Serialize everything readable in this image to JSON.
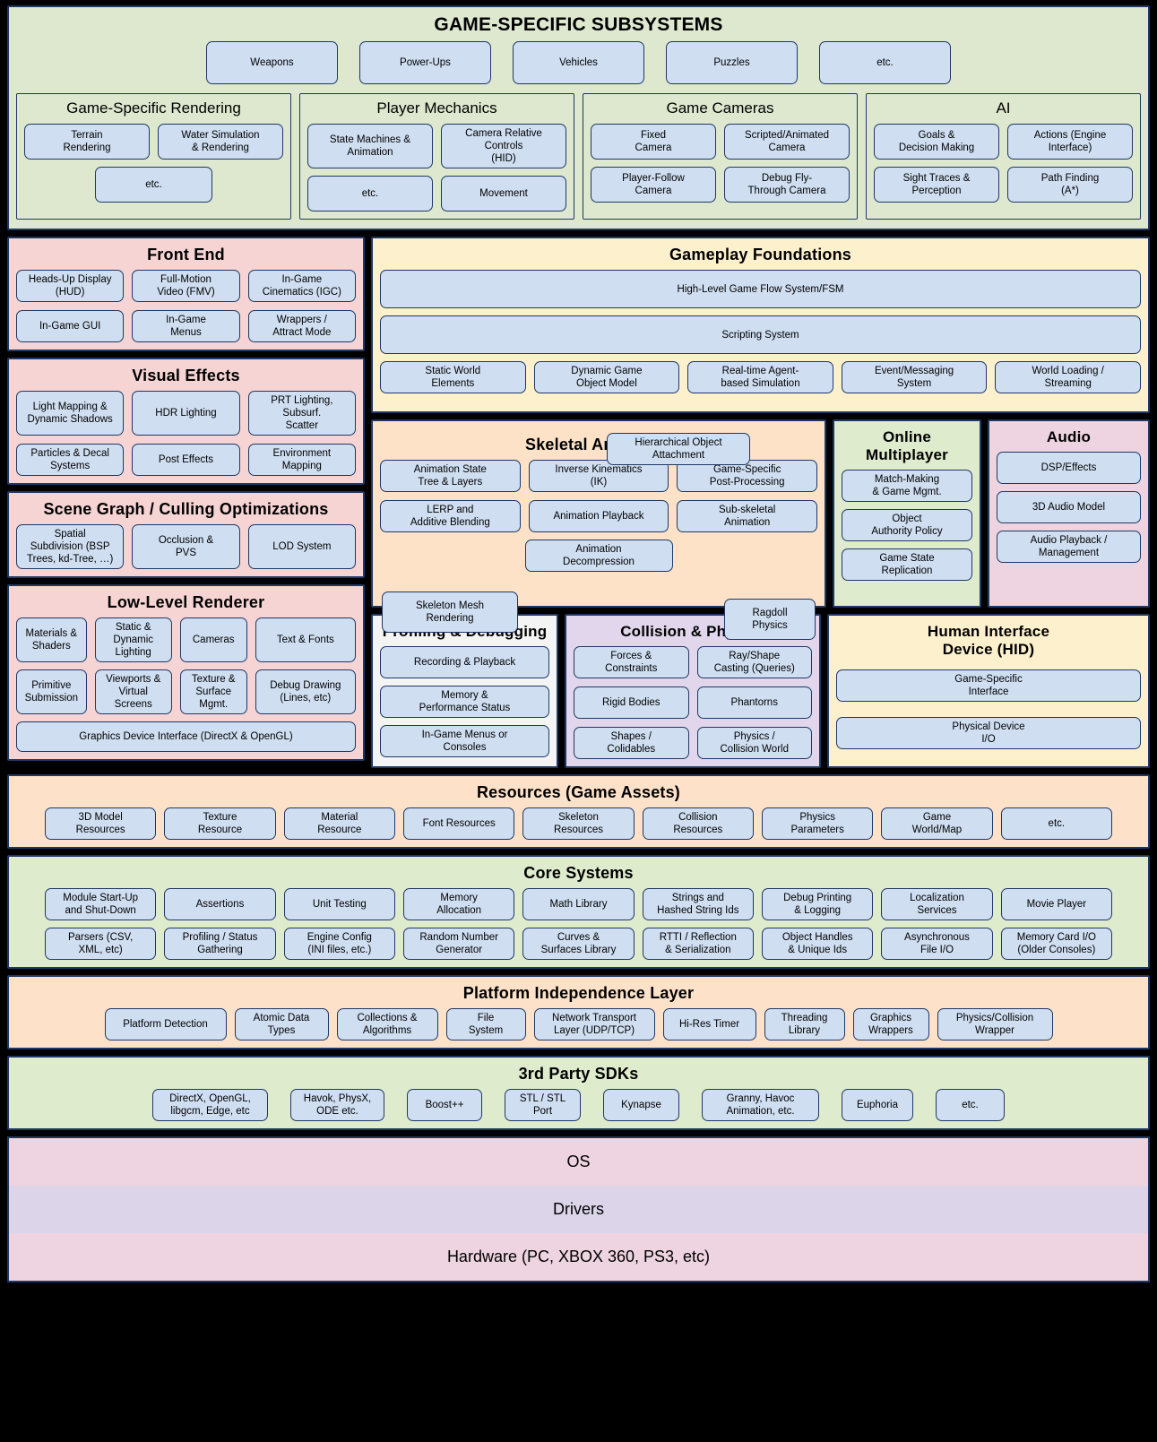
{
  "game_specific": {
    "title": "GAME-SPECIFIC SUBSYSTEMS",
    "top_items": [
      "Weapons",
      "Power-Ups",
      "Vehicles",
      "Puzzles",
      "etc."
    ],
    "panels": [
      {
        "title": "Game-Specific Rendering",
        "items": [
          "Terrain\nRendering",
          "Water Simulation\n& Rendering",
          "etc."
        ]
      },
      {
        "title": "Player Mechanics",
        "items": [
          "State Machines &\nAnimation",
          "Camera Relative Controls\n(HID)",
          "etc.",
          "Movement"
        ]
      },
      {
        "title": "Game Cameras",
        "items": [
          "Fixed\nCamera",
          "Scripted/Animated\nCamera",
          "Player-Follow\nCamera",
          "Debug Fly-\nThrough Camera"
        ]
      },
      {
        "title": "AI",
        "items": [
          "Goals &\nDecision Making",
          "Actions (Engine\nInterface)",
          "Sight Traces &\nPerception",
          "Path Finding\n(A*)"
        ]
      }
    ]
  },
  "front_end": {
    "title": "Front End",
    "items": [
      "Heads-Up Display\n(HUD)",
      "Full-Motion\nVideo (FMV)",
      "In-Game\nCinematics (IGC)",
      "In-Game GUI",
      "In-Game\nMenus",
      "Wrappers /\nAttract Mode"
    ]
  },
  "visual_effects": {
    "title": "Visual Effects",
    "items": [
      "Light Mapping  &\nDynamic Shadows",
      "HDR Lighting",
      "PRT Lighting,\nSubsurf.\nScatter",
      "Particles & Decal\nSystems",
      "Post Effects",
      "Environment\nMapping"
    ]
  },
  "scene_graph": {
    "title": "Scene Graph / Culling Optimizations",
    "items": [
      "Spatial\nSubdivision (BSP\nTrees, kd-Tree, …)",
      "Occlusion &\nPVS",
      "LOD System"
    ]
  },
  "gameplay_foundations": {
    "title": "Gameplay Foundations",
    "banners": [
      "High-Level Game Flow System/FSM",
      "Scripting System"
    ],
    "items": [
      "Static World\nElements",
      "Dynamic Game\nObject Model",
      "Real-time Agent-\nbased Simulation",
      "Event/Messaging\nSystem",
      "World Loading /\nStreaming"
    ]
  },
  "hierarchical_object_attachment": "Hierarchical Object\nAttachment",
  "skeletal_animation": {
    "title": "Skeletal Animation",
    "items": [
      "Animation State\nTree & Layers",
      "Inverse Kinematics\n(IK)",
      "Game-Specific\nPost-Processing",
      "LERP and\nAdditive Blending",
      "Animation Playback",
      "Sub-skeletal\nAnimation"
    ],
    "center_item": "Animation\nDecompression"
  },
  "skeleton_mesh_rendering": "Skeleton Mesh\nRendering",
  "ragdoll_physics": "Ragdoll\nPhysics",
  "online_multiplayer": {
    "title": "Online Multiplayer",
    "items": [
      "Match-Making\n& Game Mgmt.",
      "Object\nAuthority Policy",
      "Game State\nReplication"
    ]
  },
  "audio": {
    "title": "Audio",
    "items": [
      "DSP/Effects",
      "3D Audio Model",
      "Audio Playback /\nManagement"
    ]
  },
  "low_level_renderer": {
    "title": "Low-Level Renderer",
    "items": [
      "Materials &\nShaders",
      "Static & Dynamic\nLighting",
      "Cameras",
      "Text & Fonts",
      "Primitive\nSubmission",
      "Viewports & Virtual\nScreens",
      "Texture &\nSurface Mgmt.",
      "Debug Drawing (Lines, etc)"
    ],
    "banner": "Graphics Device Interface (DirectX & OpenGL)"
  },
  "profiling_debugging": {
    "title": "Profiling & Debugging",
    "items": [
      "Recording & Playback",
      "Memory &\nPerformance Status",
      "In-Game Menus or\nConsoles"
    ]
  },
  "collision_physics": {
    "title": "Collision & Physics",
    "items": [
      "Forces &\nConstraints",
      "Ray/Shape\nCasting (Queries)",
      "Rigid Bodies",
      "Phantorns",
      "Shapes /\nColidables",
      "Physics /\nCollision World"
    ]
  },
  "hid": {
    "title": "Human Interface\nDevice (HID)",
    "items": [
      "Game-Specific\nInterface",
      "Physical Device\nI/O"
    ]
  },
  "resources": {
    "title": "Resources (Game Assets)",
    "items": [
      "3D Model\nResources",
      "Texture\nResource",
      "Material\nResource",
      "Font Resources",
      "Skeleton\nResources",
      "Collision\nResources",
      "Physics\nParameters",
      "Game\nWorld/Map",
      "etc."
    ]
  },
  "core_systems": {
    "title": "Core Systems",
    "row1": [
      "Module Start-Up\nand Shut-Down",
      "Assertions",
      "Unit Testing",
      "Memory\nAllocation",
      "Math Library",
      "Strings and\nHashed String Ids",
      "Debug Printing\n& Logging",
      "Localization\nServices",
      "Movie Player"
    ],
    "row2": [
      "Parsers (CSV,\nXML, etc)",
      "Profiling / Status\nGathering",
      "Engine Config\n(INI files, etc.)",
      "Random Number\nGenerator",
      "Curves &\nSurfaces Library",
      "RTTI / Reflection\n& Serialization",
      "Object Handles\n& Unique Ids",
      "Asynchronous\nFile I/O",
      "Memory Card I/O\n(Older Consoles)"
    ]
  },
  "platform_independence": {
    "title": "Platform Independence Layer",
    "items": [
      "Platform Detection",
      "Atomic Data\nTypes",
      "Collections &\nAlgorithms",
      "File\nSystem",
      "Network Transport\nLayer (UDP/TCP)",
      "Hi-Res Timer",
      "Threading\nLibrary",
      "Graphics\nWrappers",
      "Physics/Collision\nWrapper"
    ]
  },
  "third_party": {
    "title": "3rd Party SDKs",
    "items": [
      "DirectX, OpenGL,\nlibgcm, Edge, etc",
      "Havok, PhysX,\nODE etc.",
      "Boost++",
      "STL / STL\nPort",
      "Kynapse",
      "Granny, Havoc\nAnimation, etc.",
      "Euphoria",
      "etc."
    ]
  },
  "platform_stack": {
    "os": "OS",
    "drivers": "Drivers",
    "hardware": "Hardware (PC, XBOX 360, PS3, etc)"
  }
}
